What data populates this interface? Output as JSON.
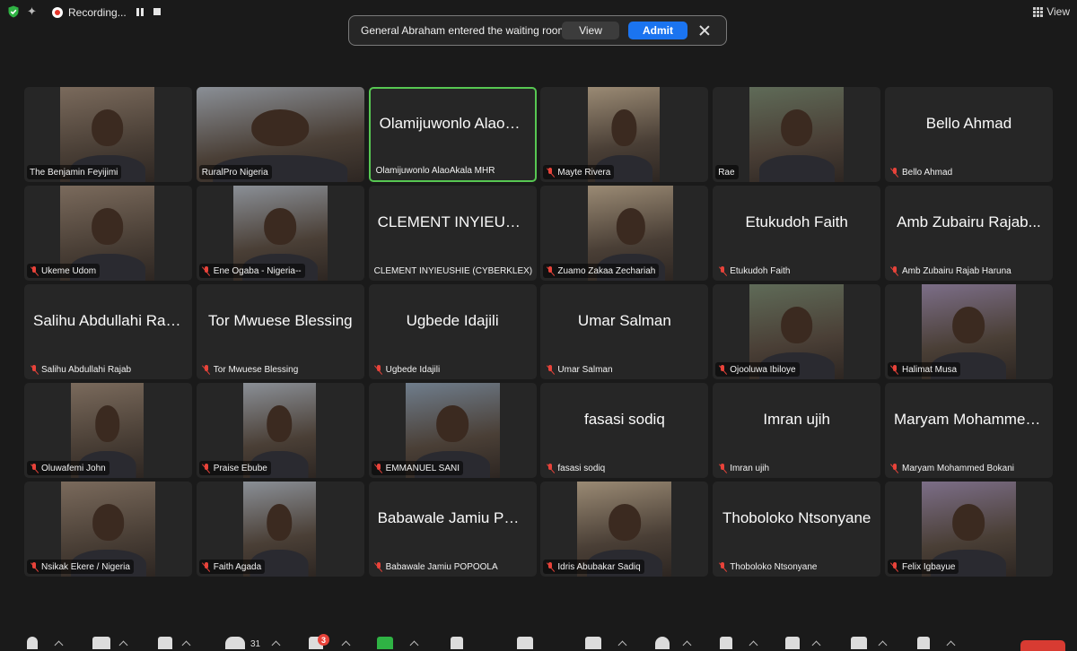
{
  "topbar": {
    "recording_label": "Recording...",
    "view_label": "View"
  },
  "notification": {
    "message": "General Abraham entered the waiting room",
    "view_label": "View",
    "admit_label": "Admit"
  },
  "participants": [
    {
      "name": "The Benjamin Feyijimi",
      "muted": false,
      "video": true
    },
    {
      "name": "RuralPro Nigeria",
      "muted": false,
      "video": true
    },
    {
      "name": "Olamijuwonlo AlaoAkala MHR",
      "display": "Olamijuwonlo AlaoA...",
      "muted": false,
      "video": false,
      "speaking": true
    },
    {
      "name": "Mayte Rivera",
      "muted": true,
      "video": true
    },
    {
      "name": "Rae",
      "muted": false,
      "video": true
    },
    {
      "name": "Bello Ahmad",
      "display": "Bello Ahmad",
      "muted": true,
      "video": false
    },
    {
      "name": "Ukeme Udom",
      "muted": true,
      "video": true
    },
    {
      "name": "Ene Ogaba - Nigeria--",
      "muted": true,
      "video": true
    },
    {
      "name": "CLEMENT INYIEUSHIE (CYBERKLEX)",
      "display": "CLEMENT INYIEUSH...",
      "muted": false,
      "video": false
    },
    {
      "name": "Zuamo Zakaa Zechariah",
      "muted": true,
      "video": true
    },
    {
      "name": "Etukudoh Faith",
      "display": "Etukudoh Faith",
      "muted": true,
      "video": false
    },
    {
      "name": "Amb Zubairu Rajab Haruna",
      "display": "Amb Zubairu Rajab...",
      "muted": true,
      "video": false
    },
    {
      "name": "Salihu Abdullahi Rajab",
      "display": "Salihu Abdullahi Rajab",
      "muted": true,
      "video": false
    },
    {
      "name": "Tor Mwuese Blessing",
      "display": "Tor Mwuese Blessing",
      "muted": true,
      "video": false
    },
    {
      "name": "Ugbede Idajili",
      "display": "Ugbede Idajili",
      "muted": true,
      "video": false
    },
    {
      "name": "Umar Salman",
      "display": "Umar Salman",
      "muted": true,
      "video": false
    },
    {
      "name": "Ojooluwa Ibiloye",
      "muted": true,
      "video": true
    },
    {
      "name": "Halimat Musa",
      "muted": true,
      "video": true
    },
    {
      "name": "Oluwafemi John",
      "muted": true,
      "video": true
    },
    {
      "name": "Praise Ebube",
      "muted": true,
      "video": true
    },
    {
      "name": "EMMANUEL SANI",
      "muted": true,
      "video": true
    },
    {
      "name": "fasasi sodiq",
      "display": "fasasi sodiq",
      "muted": true,
      "video": false
    },
    {
      "name": "Imran ujih",
      "display": "Imran ujih",
      "muted": true,
      "video": false
    },
    {
      "name": "Maryam Mohammed Bokani",
      "display": "Maryam Mohammed...",
      "muted": true,
      "video": false
    },
    {
      "name": "Nsikak Ekere / Nigeria",
      "muted": true,
      "video": true
    },
    {
      "name": "Faith Agada",
      "muted": true,
      "video": true
    },
    {
      "name": "Babawale Jamiu POPOOLA",
      "display": "Babawale Jamiu PO...",
      "muted": true,
      "video": false
    },
    {
      "name": "Idris Abubakar Sadiq",
      "muted": true,
      "video": true
    },
    {
      "name": "Thoboloko Ntsonyane",
      "display": "Thoboloko Ntsonyane",
      "muted": true,
      "video": false
    },
    {
      "name": "Felix Igbayue",
      "muted": true,
      "video": true
    }
  ],
  "toolbar": {
    "participants_count": "31",
    "chat_badge": "3"
  },
  "colors": {
    "accent": "#1b74f0",
    "speaking_border": "#57c752",
    "mute_red": "#e8433a",
    "tile_bg": "#262626"
  }
}
